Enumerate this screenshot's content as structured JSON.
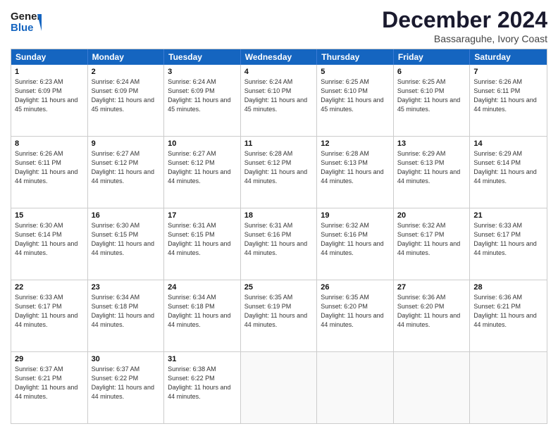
{
  "header": {
    "logo_general": "General",
    "logo_blue": "Blue",
    "month_title": "December 2024",
    "subtitle": "Bassaraguhe, Ivory Coast"
  },
  "calendar": {
    "days": [
      "Sunday",
      "Monday",
      "Tuesday",
      "Wednesday",
      "Thursday",
      "Friday",
      "Saturday"
    ],
    "rows": [
      [
        {
          "day": "1",
          "rise": "6:23 AM",
          "set": "6:09 PM",
          "daylight": "11 hours and 45 minutes."
        },
        {
          "day": "2",
          "rise": "6:24 AM",
          "set": "6:09 PM",
          "daylight": "11 hours and 45 minutes."
        },
        {
          "day": "3",
          "rise": "6:24 AM",
          "set": "6:09 PM",
          "daylight": "11 hours and 45 minutes."
        },
        {
          "day": "4",
          "rise": "6:24 AM",
          "set": "6:10 PM",
          "daylight": "11 hours and 45 minutes."
        },
        {
          "day": "5",
          "rise": "6:25 AM",
          "set": "6:10 PM",
          "daylight": "11 hours and 45 minutes."
        },
        {
          "day": "6",
          "rise": "6:25 AM",
          "set": "6:10 PM",
          "daylight": "11 hours and 45 minutes."
        },
        {
          "day": "7",
          "rise": "6:26 AM",
          "set": "6:11 PM",
          "daylight": "11 hours and 44 minutes."
        }
      ],
      [
        {
          "day": "8",
          "rise": "6:26 AM",
          "set": "6:11 PM",
          "daylight": "11 hours and 44 minutes."
        },
        {
          "day": "9",
          "rise": "6:27 AM",
          "set": "6:12 PM",
          "daylight": "11 hours and 44 minutes."
        },
        {
          "day": "10",
          "rise": "6:27 AM",
          "set": "6:12 PM",
          "daylight": "11 hours and 44 minutes."
        },
        {
          "day": "11",
          "rise": "6:28 AM",
          "set": "6:12 PM",
          "daylight": "11 hours and 44 minutes."
        },
        {
          "day": "12",
          "rise": "6:28 AM",
          "set": "6:13 PM",
          "daylight": "11 hours and 44 minutes."
        },
        {
          "day": "13",
          "rise": "6:29 AM",
          "set": "6:13 PM",
          "daylight": "11 hours and 44 minutes."
        },
        {
          "day": "14",
          "rise": "6:29 AM",
          "set": "6:14 PM",
          "daylight": "11 hours and 44 minutes."
        }
      ],
      [
        {
          "day": "15",
          "rise": "6:30 AM",
          "set": "6:14 PM",
          "daylight": "11 hours and 44 minutes."
        },
        {
          "day": "16",
          "rise": "6:30 AM",
          "set": "6:15 PM",
          "daylight": "11 hours and 44 minutes."
        },
        {
          "day": "17",
          "rise": "6:31 AM",
          "set": "6:15 PM",
          "daylight": "11 hours and 44 minutes."
        },
        {
          "day": "18",
          "rise": "6:31 AM",
          "set": "6:16 PM",
          "daylight": "11 hours and 44 minutes."
        },
        {
          "day": "19",
          "rise": "6:32 AM",
          "set": "6:16 PM",
          "daylight": "11 hours and 44 minutes."
        },
        {
          "day": "20",
          "rise": "6:32 AM",
          "set": "6:17 PM",
          "daylight": "11 hours and 44 minutes."
        },
        {
          "day": "21",
          "rise": "6:33 AM",
          "set": "6:17 PM",
          "daylight": "11 hours and 44 minutes."
        }
      ],
      [
        {
          "day": "22",
          "rise": "6:33 AM",
          "set": "6:17 PM",
          "daylight": "11 hours and 44 minutes."
        },
        {
          "day": "23",
          "rise": "6:34 AM",
          "set": "6:18 PM",
          "daylight": "11 hours and 44 minutes."
        },
        {
          "day": "24",
          "rise": "6:34 AM",
          "set": "6:18 PM",
          "daylight": "11 hours and 44 minutes."
        },
        {
          "day": "25",
          "rise": "6:35 AM",
          "set": "6:19 PM",
          "daylight": "11 hours and 44 minutes."
        },
        {
          "day": "26",
          "rise": "6:35 AM",
          "set": "6:20 PM",
          "daylight": "11 hours and 44 minutes."
        },
        {
          "day": "27",
          "rise": "6:36 AM",
          "set": "6:20 PM",
          "daylight": "11 hours and 44 minutes."
        },
        {
          "day": "28",
          "rise": "6:36 AM",
          "set": "6:21 PM",
          "daylight": "11 hours and 44 minutes."
        }
      ],
      [
        {
          "day": "29",
          "rise": "6:37 AM",
          "set": "6:21 PM",
          "daylight": "11 hours and 44 minutes."
        },
        {
          "day": "30",
          "rise": "6:37 AM",
          "set": "6:22 PM",
          "daylight": "11 hours and 44 minutes."
        },
        {
          "day": "31",
          "rise": "6:38 AM",
          "set": "6:22 PM",
          "daylight": "11 hours and 44 minutes."
        },
        null,
        null,
        null,
        null
      ]
    ]
  }
}
